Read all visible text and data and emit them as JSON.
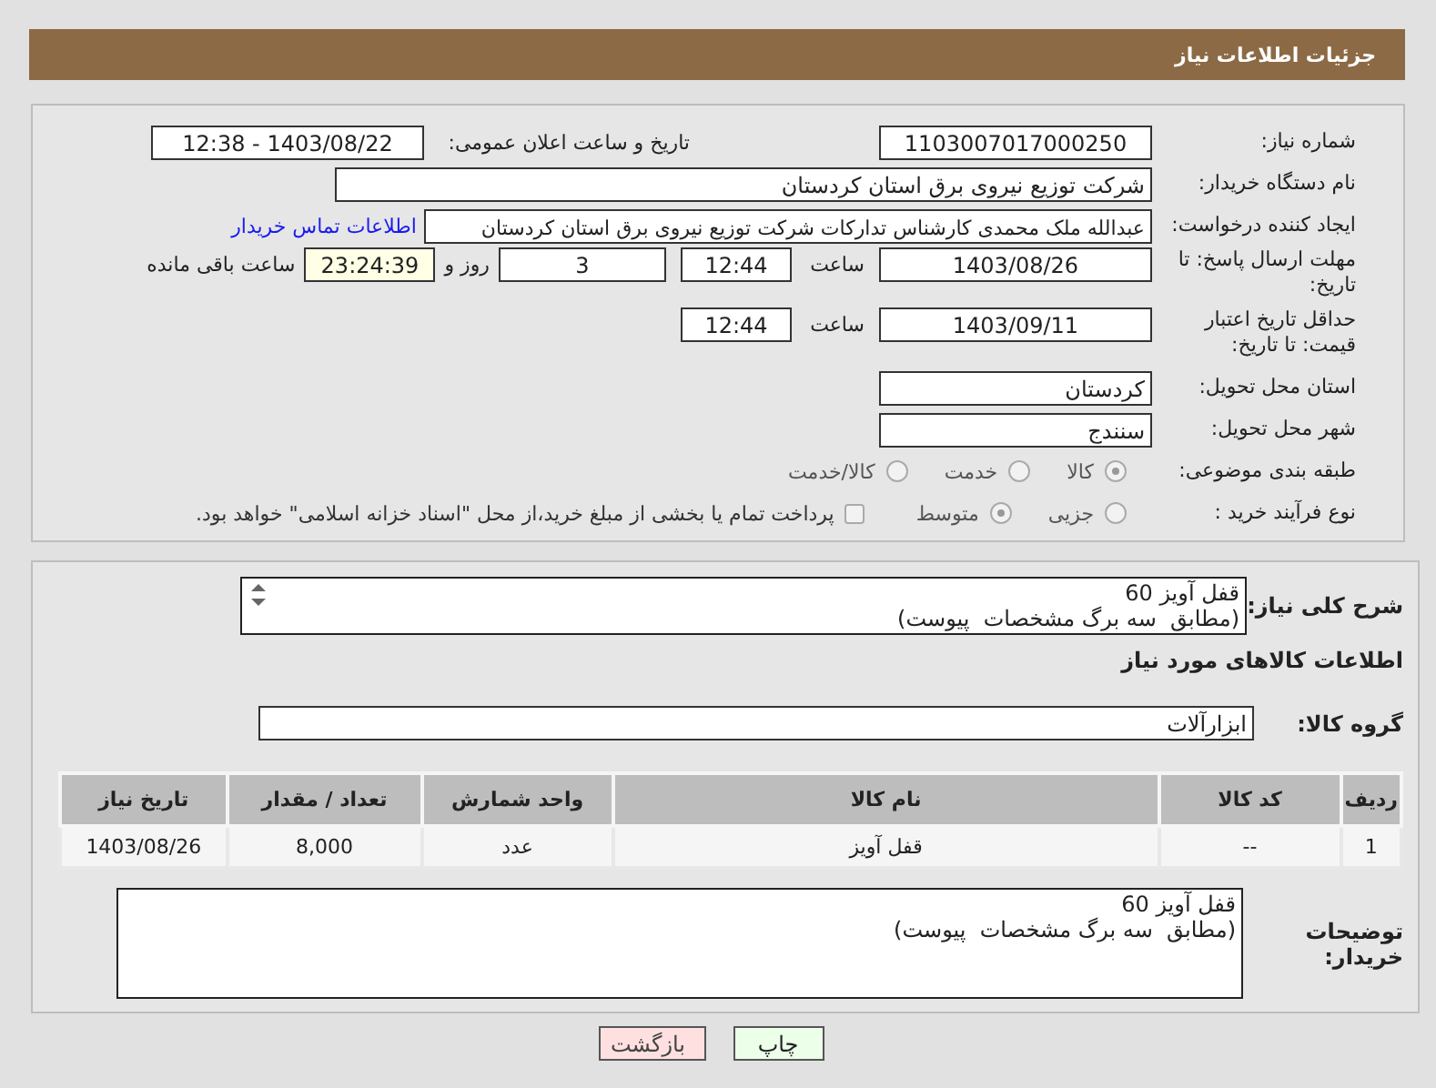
{
  "header": {
    "title": "جزئیات اطلاعات نیاز"
  },
  "need_number": {
    "label": "شماره نیاز:",
    "value": "1103007017000250"
  },
  "announce": {
    "label": "تاریخ و ساعت اعلان عمومی:",
    "value": "1403/08/22 - 12:38"
  },
  "buyer_org": {
    "label": "نام دستگاه خریدار:",
    "value": "شرکت توزیع نیروی برق استان کردستان"
  },
  "requester": {
    "label": "ایجاد کننده درخواست:",
    "value": "عبدالله ملک محمدی کارشناس تدارکات شرکت توزیع نیروی برق استان کردستان",
    "link": "اطلاعات تماس خریدار"
  },
  "reply_deadline": {
    "label": "مهلت ارسال پاسخ: تا تاریخ:",
    "date": "1403/08/26",
    "time_label": "ساعت",
    "time": "12:44",
    "days": "3",
    "days_label": "روز و",
    "remaining": "23:24:39",
    "remaining_label": "ساعت باقی مانده"
  },
  "price_validity": {
    "label": "حداقل تاریخ اعتبار قیمت: تا تاریخ:",
    "date": "1403/09/11",
    "time_label": "ساعت",
    "time": "12:44"
  },
  "province": {
    "label": "استان محل تحویل:",
    "value": "کردستان"
  },
  "city": {
    "label": "شهر محل تحویل:",
    "value": "سنندج"
  },
  "category": {
    "label": "طبقه بندی موضوعی:",
    "options": [
      {
        "label": "کالا",
        "selected": true
      },
      {
        "label": "خدمت",
        "selected": false
      },
      {
        "label": "کالا/خدمت",
        "selected": false
      }
    ]
  },
  "process": {
    "label": "نوع فرآیند خرید :",
    "options": [
      {
        "label": "جزیی",
        "selected": false
      },
      {
        "label": "متوسط",
        "selected": true
      }
    ],
    "treasury": {
      "label": "پرداخت تمام یا بخشی از مبلغ خرید،از محل \"اسناد خزانه اسلامی\" خواهد بود.",
      "checked": false
    }
  },
  "description": {
    "label": "شرح کلی نیاز:",
    "lines": [
      "قفل آویز 60",
      "(مطابق  سه برگ مشخصات  پیوست)"
    ]
  },
  "goods_heading": "اطلاعات کالاهای مورد نیاز",
  "goods_group": {
    "label": "گروه کالا:",
    "value": "ابزارآلات"
  },
  "table": {
    "columns": [
      "ردیف",
      "کد کالا",
      "نام کالا",
      "واحد شمارش",
      "تعداد / مقدار",
      "تاریخ نیاز"
    ],
    "rows": [
      [
        "1",
        "--",
        "قفل آویز",
        "عدد",
        "8,000",
        "1403/08/26"
      ]
    ]
  },
  "buyer_notes": {
    "label": "توضیحات خریدار:",
    "lines": [
      "قفل آویز 60",
      "(مطابق  سه برگ مشخصات  پیوست)"
    ]
  },
  "buttons": [
    {
      "label": "چاپ",
      "kind": "print"
    },
    {
      "label": "بازگشت",
      "kind": "back"
    }
  ]
}
